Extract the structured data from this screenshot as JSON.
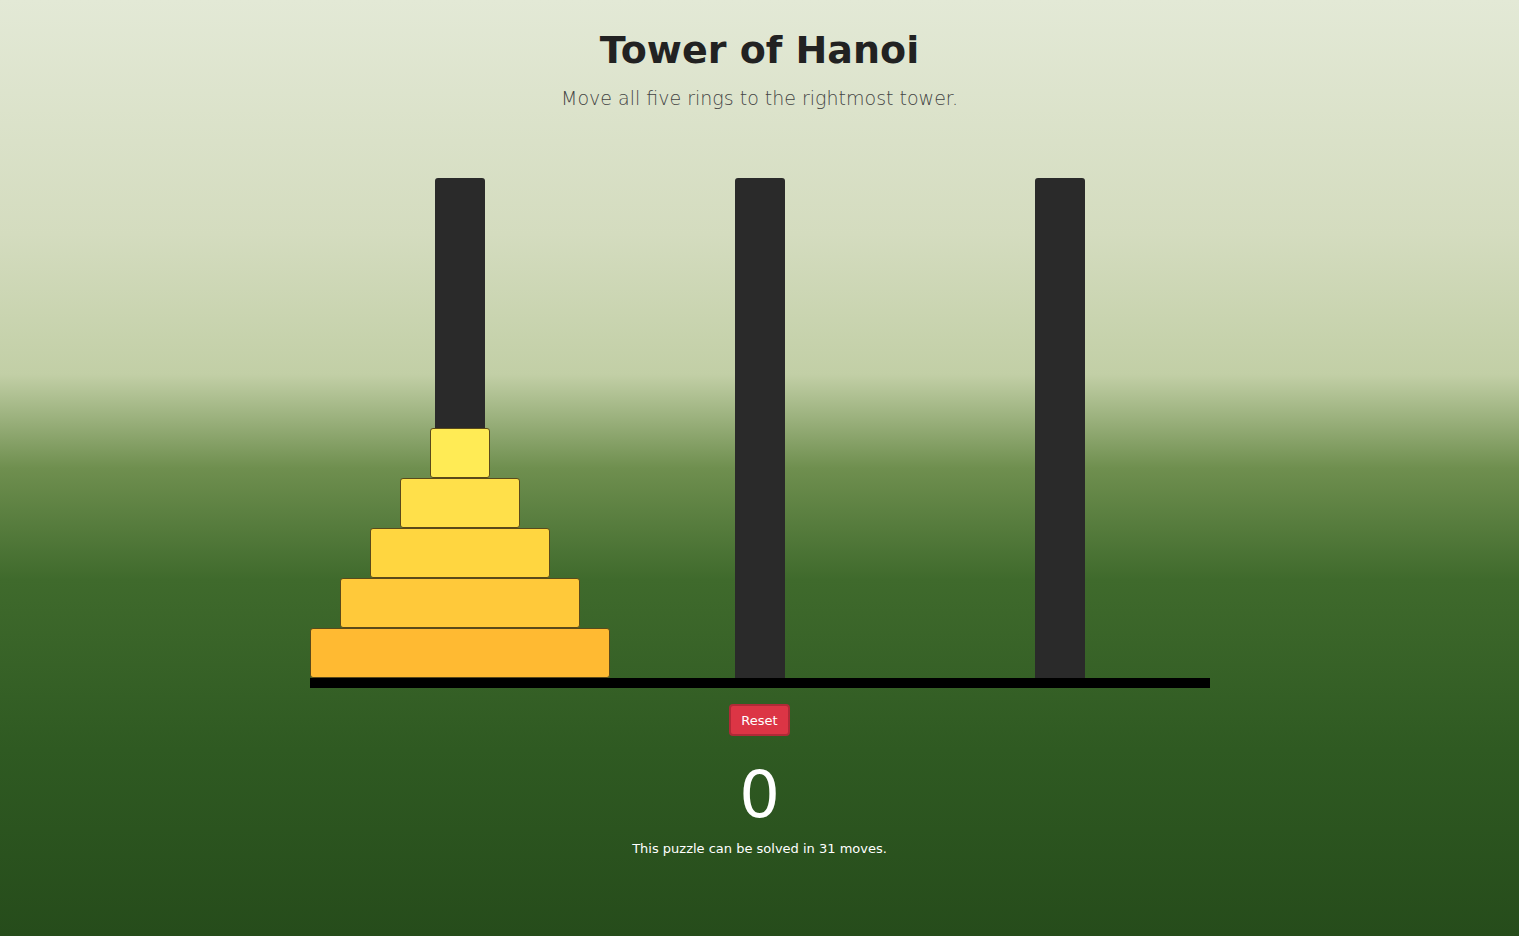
{
  "title": "Tower of Hanoi",
  "subtitle": "Move all five rings to the rightmost tower.",
  "towers": [
    {
      "discs": [
        {
          "size": 5
        },
        {
          "size": 4
        },
        {
          "size": 3
        },
        {
          "size": 2
        },
        {
          "size": 1
        }
      ]
    },
    {
      "discs": []
    },
    {
      "discs": []
    }
  ],
  "reset_button": "Reset",
  "move_count": "0",
  "caption": "This puzzle can be solved in 31 moves."
}
